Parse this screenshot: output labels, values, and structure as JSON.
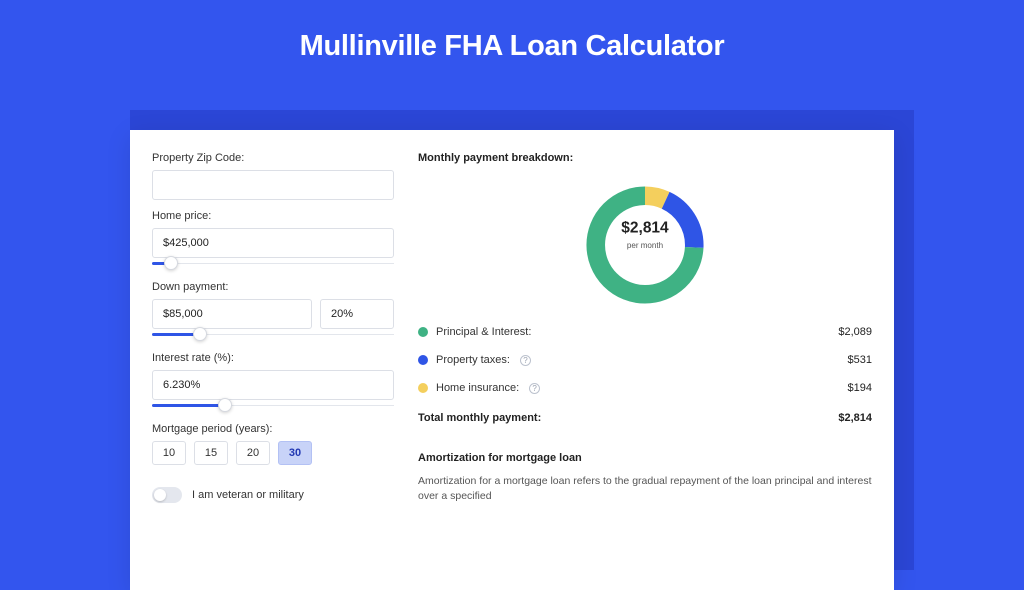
{
  "title": "Mullinville FHA Loan Calculator",
  "chart_data": {
    "type": "pie",
    "donut": true,
    "title": "Monthly payment breakdown",
    "total": 2814,
    "center_label": "$2,814",
    "center_sub": "per month",
    "series": [
      {
        "name": "Principal & Interest",
        "value": 2089,
        "color": "#3fb284"
      },
      {
        "name": "Property taxes",
        "value": 531,
        "color": "#2f55e6"
      },
      {
        "name": "Home insurance",
        "value": 194,
        "color": "#f4cf5d"
      }
    ]
  },
  "form": {
    "zip": {
      "label": "Property Zip Code:",
      "value": ""
    },
    "home_price": {
      "label": "Home price:",
      "value": "$425,000",
      "slider_pct": 8
    },
    "down_payment": {
      "label": "Down payment:",
      "value": "$85,000",
      "pct": "20%",
      "slider_pct": 20
    },
    "interest_rate": {
      "label": "Interest rate (%):",
      "value": "6.230%",
      "slider_pct": 30
    },
    "mortgage_period": {
      "label": "Mortgage period (years):",
      "options": [
        "10",
        "15",
        "20",
        "30"
      ],
      "selected": "30"
    },
    "veteran": {
      "label": "I am veteran or military",
      "checked": false
    }
  },
  "right": {
    "breakdown_title": "Monthly payment breakdown:",
    "items": [
      {
        "label": "Principal & Interest:",
        "value": "$2,089",
        "dot": "green",
        "help": false
      },
      {
        "label": "Property taxes:",
        "value": "$531",
        "dot": "blue",
        "help": true
      },
      {
        "label": "Home insurance:",
        "value": "$194",
        "dot": "yellow",
        "help": true
      }
    ],
    "total_label": "Total monthly payment:",
    "total_value": "$2,814",
    "amort_title": "Amortization for mortgage loan",
    "amort_body": "Amortization for a mortgage loan refers to the gradual repayment of the loan principal and interest over a specified"
  }
}
